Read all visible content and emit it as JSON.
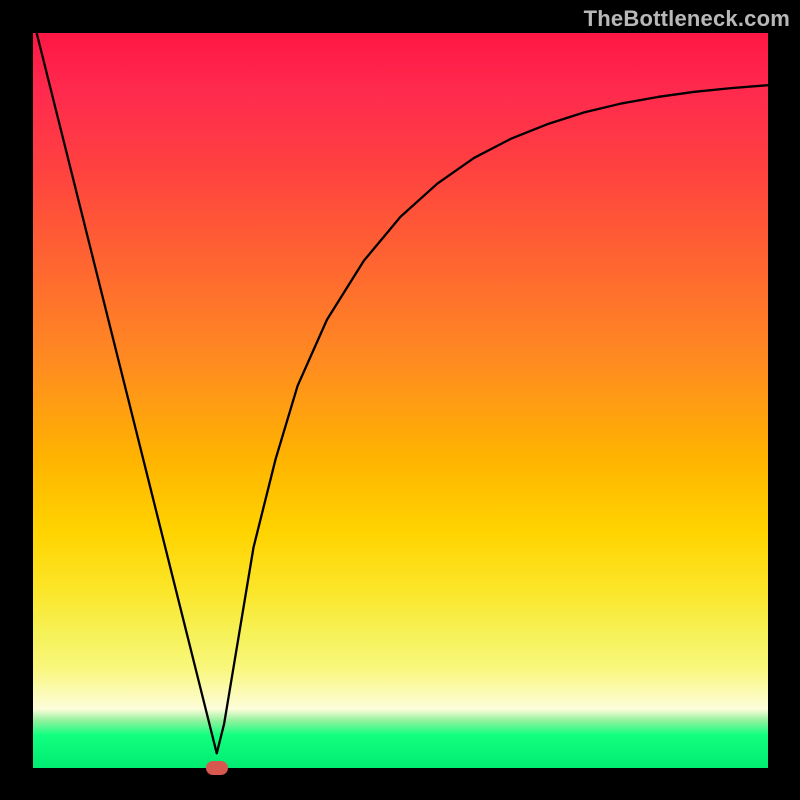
{
  "watermark": "TheBottleneck.com",
  "chart_data": {
    "type": "line",
    "title": "",
    "xlabel": "",
    "ylabel": "",
    "xlim": [
      0,
      100
    ],
    "ylim": [
      0,
      100
    ],
    "series": [
      {
        "name": "bottleneck-curve",
        "x": [
          0,
          2,
          4,
          6,
          8,
          10,
          12,
          14,
          16,
          18,
          20,
          22,
          24,
          25,
          26,
          28,
          30,
          33,
          36,
          40,
          45,
          50,
          55,
          60,
          65,
          70,
          75,
          80,
          85,
          90,
          95,
          100
        ],
        "y": [
          102,
          94,
          86,
          78,
          70,
          62,
          54,
          46,
          38,
          30,
          22,
          14,
          6,
          2,
          6,
          18,
          30,
          42,
          52,
          61,
          69,
          75,
          79.5,
          83,
          85.6,
          87.6,
          89.2,
          90.4,
          91.3,
          92,
          92.5,
          92.9
        ]
      }
    ],
    "markers": [
      {
        "name": "optimum-marker",
        "x": 25,
        "y": 0
      }
    ],
    "background_gradient": {
      "top": "#ff1744",
      "mid": "#ffd400",
      "bottom": "#00ec72"
    }
  }
}
